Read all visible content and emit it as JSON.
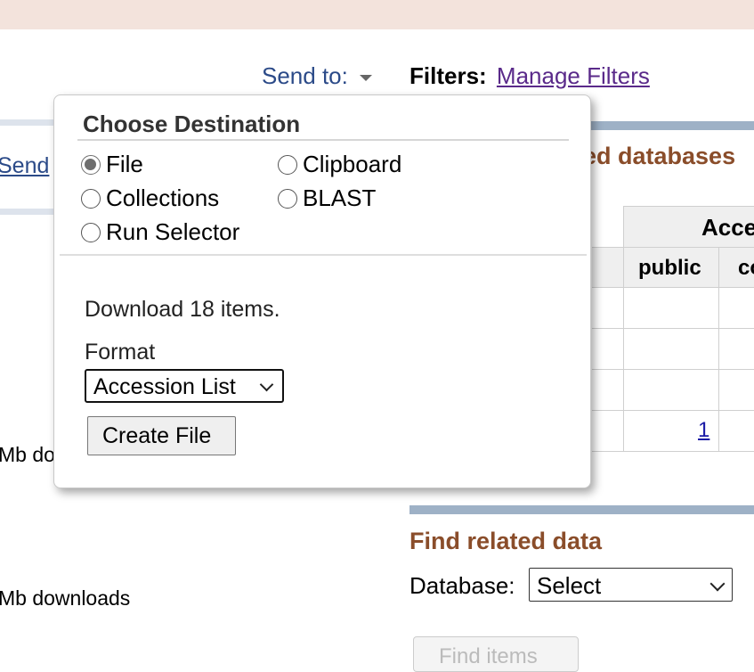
{
  "header": {
    "send_to_label": "Send to:",
    "filters_label": "Filters:",
    "manage_filters_link": "Manage Filters"
  },
  "background_left": {
    "send_link": "Send",
    "mb_text_1": "Mb do",
    "mb_text_2": "Mb downloads"
  },
  "background_right": {
    "related_databases_title": "ed databases",
    "access_header": "Acce",
    "public_header": "public",
    "co_header": "co",
    "row_link": "1",
    "find_related_title": "Find related data",
    "database_label": "Database:",
    "database_select_value": "Select",
    "find_items_button": "Find items"
  },
  "popup": {
    "title": "Choose Destination",
    "destinations": {
      "file": "File",
      "clipboard": "Clipboard",
      "collections": "Collections",
      "blast": "BLAST",
      "run_selector": "Run Selector"
    },
    "selected_destination": "File",
    "download_text": "Download 18 items.",
    "format_label": "Format",
    "format_value": "Accession List",
    "create_button": "Create File"
  },
  "colors": {
    "banner": "#f3e3dc",
    "link_blue": "#2b4a88",
    "visited_link": "#5a2a8a",
    "section_title_brown": "#8a4d2a",
    "section_bar": "#9eb1c6"
  }
}
